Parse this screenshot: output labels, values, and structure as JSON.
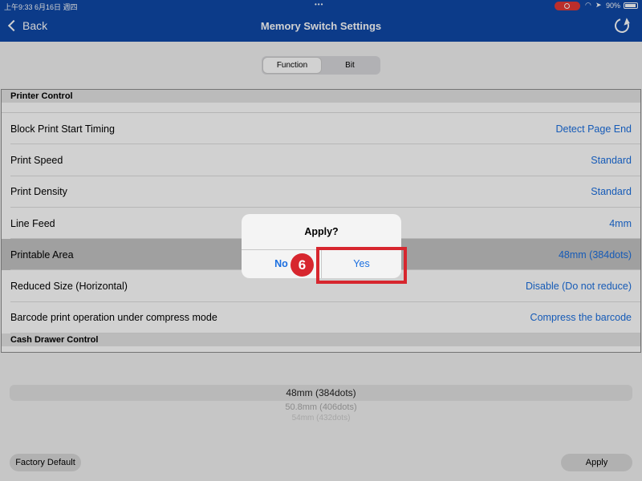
{
  "status_bar": {
    "time": "上午9:33   6月16日 週四",
    "dots": "•••",
    "battery": "90%"
  },
  "nav": {
    "back_label": "Back",
    "title": "Memory Switch Settings"
  },
  "segments": [
    "Function",
    "Bit"
  ],
  "sections": [
    {
      "header": "Printer Control",
      "rows": [
        {
          "label": "Block Print Start Timing",
          "value": "Detect Page End"
        },
        {
          "label": "Print Speed",
          "value": "Standard"
        },
        {
          "label": "Print Density",
          "value": "Standard"
        },
        {
          "label": "Line Feed",
          "value": "4mm"
        },
        {
          "label": "Printable Area",
          "value": "48mm (384dots)"
        },
        {
          "label": "Reduced Size (Horizontal)",
          "value": "Disable (Do not reduce)"
        },
        {
          "label": "Barcode print operation under compress mode",
          "value": "Compress the barcode"
        }
      ]
    },
    {
      "header": "Cash Drawer Control"
    }
  ],
  "picker": {
    "options": [
      "48mm (384dots)",
      "50.8mm (406dots)",
      "54mm (432dots)"
    ]
  },
  "buttons": {
    "factory_default": "Factory Default",
    "apply": "Apply"
  },
  "dialog": {
    "title": "Apply?",
    "no": "No",
    "yes": "Yes"
  },
  "annotation": {
    "step": "6"
  },
  "colors": {
    "nav_bg": "#0f48a8",
    "accent": "#1b6fe0",
    "callout": "#d7262e"
  }
}
